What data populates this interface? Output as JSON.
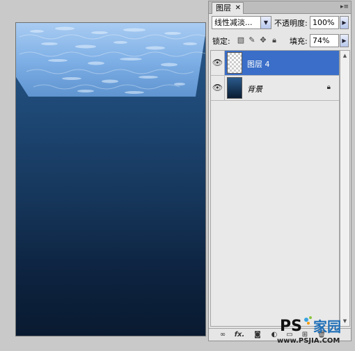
{
  "canvas": {
    "gradient_top_color": "#2a5a8c",
    "gradient_bottom_color": "#091a30",
    "water_texture_color": "#9cc4ee"
  },
  "layers_panel": {
    "tab_label": "图层",
    "tab_close_icon": "close-icon",
    "menu_icon": "panel-menu-icon",
    "blend_mode": "线性减淡...",
    "opacity_label": "不透明度:",
    "opacity_value": "100%",
    "lock_label": "锁定:",
    "lock_icons": [
      "lock-transparent-icon",
      "lock-paint-icon",
      "lock-move-icon",
      "lock-all-icon"
    ],
    "fill_label": "填充:",
    "fill_value": "74%",
    "selection_color": "#3a6ec8",
    "layers": [
      {
        "name": "图层 4",
        "selected": true,
        "visible": true,
        "locked": false
      },
      {
        "name": "背景",
        "selected": false,
        "visible": true,
        "locked": true
      }
    ],
    "bottom_icons": [
      "link-icon",
      "fx-icon",
      "mask-icon",
      "adjustment-icon",
      "group-icon",
      "new-layer-icon",
      "trash-icon"
    ],
    "bottom_fx_label": "fx."
  },
  "watermark": {
    "logo_text": "PS",
    "logo_cn": "家园",
    "url": "www.PSJIA.COM"
  }
}
